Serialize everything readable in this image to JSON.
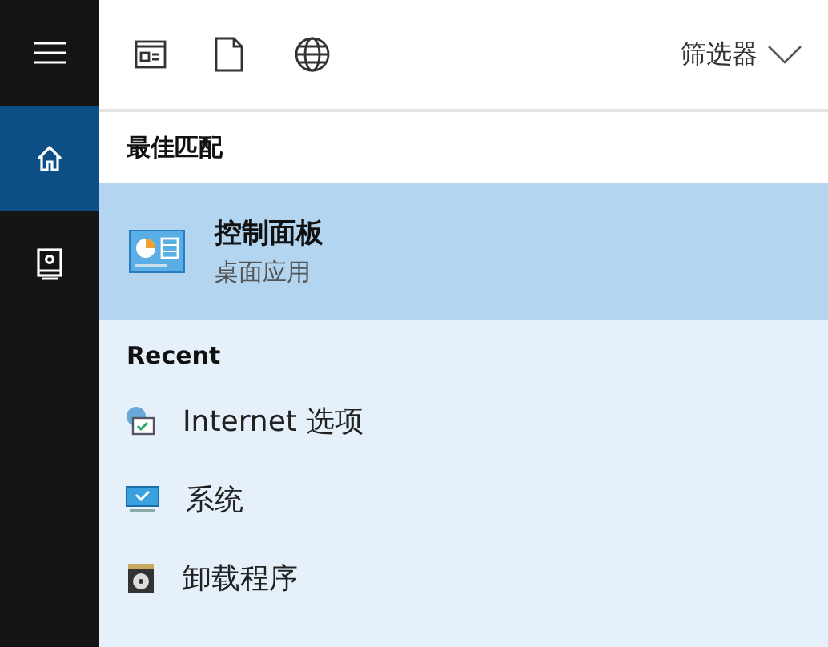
{
  "sidebar": {
    "items": [
      {
        "kind": "home",
        "selected": true
      },
      {
        "kind": "notebook",
        "selected": false
      }
    ]
  },
  "toolbar": {
    "filters": [
      {
        "kind": "apps"
      },
      {
        "kind": "documents"
      },
      {
        "kind": "web"
      }
    ],
    "filter_button": "筛选器"
  },
  "best_match": {
    "heading": "最佳匹配",
    "item": {
      "title": "控制面板",
      "subtitle": "桌面应用",
      "selected": true
    }
  },
  "recent": {
    "heading": "Recent",
    "items": [
      {
        "kind": "internet",
        "label": "Internet 选项"
      },
      {
        "kind": "system",
        "label": "系统"
      },
      {
        "kind": "uninstall",
        "label": "卸载程序"
      }
    ]
  }
}
